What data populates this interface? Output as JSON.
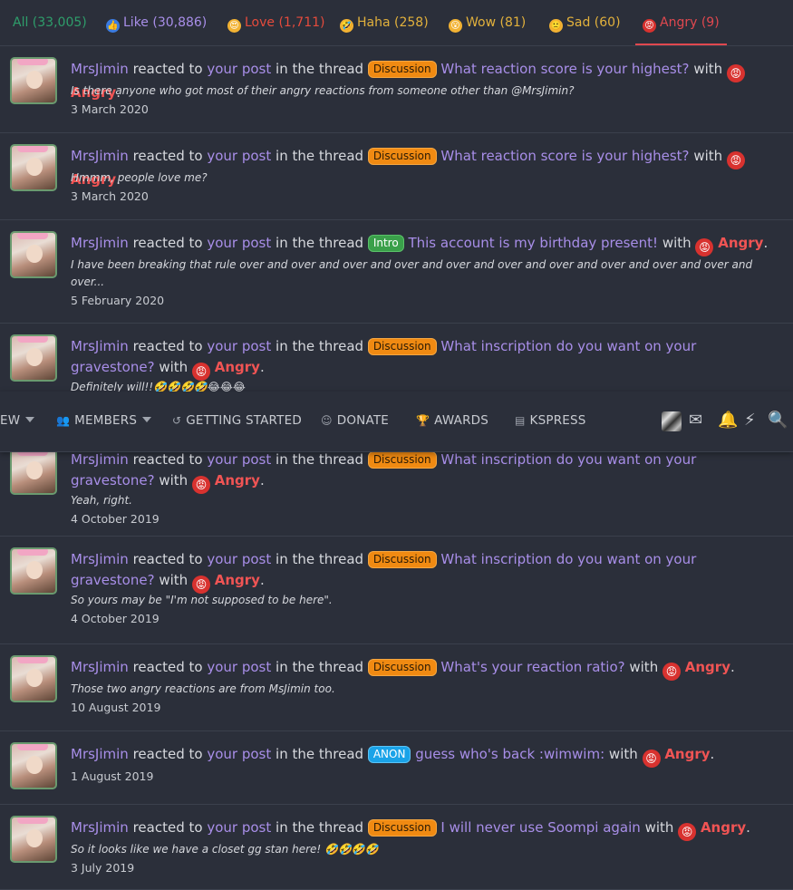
{
  "tabs": [
    {
      "label": "All (33,005)",
      "color": "#2e9e6b",
      "icon": ""
    },
    {
      "label": "Like (30,886)",
      "color": "#a88ee8",
      "icon": "like-icon"
    },
    {
      "label": "Love (1,711)",
      "color": "#e54b3c",
      "icon": "love-icon"
    },
    {
      "label": "Haha (258)",
      "color": "#e2b13c",
      "icon": "haha-icon"
    },
    {
      "label": "Wow (81)",
      "color": "#e2b13c",
      "icon": "wow-icon"
    },
    {
      "label": "Sad (60)",
      "color": "#e2b13c",
      "icon": "sad-icon"
    },
    {
      "label": "Angry (9)",
      "color": "#e0484f",
      "icon": "angry-icon"
    }
  ],
  "active_tab": "Angry (9)",
  "strings": {
    "reacted_to": "reacted to",
    "your_post": "your post",
    "in_the_thread": "in the thread",
    "with": "with",
    "angry": "Angry",
    "period": "."
  },
  "notifications": [
    {
      "user": "MrsJimin",
      "prefix": "Discussion",
      "title": "What reaction score is your highest?",
      "snippet": "Is there anyone who got most of their angry reactions from someone other than @MrsJimin?",
      "date": "3 March 2020"
    },
    {
      "user": "MrsJimin",
      "prefix": "Discussion",
      "title": "What reaction score is your highest?",
      "snippet": "Hmmm, people love me?",
      "date": "3 March 2020"
    },
    {
      "user": "MrsJimin",
      "prefix": "Intro",
      "title": "This account is my birthday present!",
      "snippet": "I have been breaking that rule over and over and over and over and over and over and over and over and over and over and over...",
      "date": "5 February 2020"
    },
    {
      "user": "MrsJimin",
      "prefix": "Discussion",
      "title": "What inscription do you want on your gravestone?",
      "snippet": "Definitely will!!🤣🤣🤣🤣😂😂😂",
      "date": ""
    },
    {
      "user": "MrsJimin",
      "prefix": "Discussion",
      "title": "What inscription do you want on your gravestone?",
      "snippet": "Yeah, right.",
      "date": "4 October 2019"
    },
    {
      "user": "MrsJimin",
      "prefix": "Discussion",
      "title": "What inscription do you want on your gravestone?",
      "snippet": "So yours may be \"I'm not supposed to be here\".",
      "date": "4 October 2019"
    },
    {
      "user": "MrsJimin",
      "prefix": "Discussion",
      "title": "What's your reaction ratio?",
      "snippet": "Those two angry reactions are from MsJimin too.",
      "date": "10 August 2019"
    },
    {
      "user": "MrsJimin",
      "prefix": "ANON",
      "title": "guess who's back :wimwim:",
      "snippet": "",
      "date": "1 August 2019"
    },
    {
      "user": "MrsJimin",
      "prefix": "Discussion",
      "title": "I will never use Soompi again",
      "snippet": "So it looks like we have a closet gg stan here! 🤣🤣🤣🤣",
      "date": "3 July 2019"
    }
  ],
  "prefix_colors": {
    "Discussion": {
      "bg": "#f08a12",
      "border": "#f5a742",
      "text": "#2a1a05"
    },
    "Intro": {
      "bg": "#3aa04a",
      "border": "#5bc26a",
      "text": "#ffffff"
    },
    "ANON": {
      "bg": "#1aa3e8",
      "border": "#5cc3f5",
      "text": "#ffffff"
    }
  },
  "nav": {
    "items": [
      {
        "label": "EW",
        "icon": "",
        "chevron": true
      },
      {
        "label": "MEMBERS",
        "icon": "members-icon",
        "chevron": true
      },
      {
        "label": "GETTING STARTED",
        "icon": "getting-started-icon",
        "chevron": false
      },
      {
        "label": "DONATE",
        "icon": "donate-icon",
        "chevron": false
      },
      {
        "label": "AWARDS",
        "icon": "trophy-icon",
        "chevron": false
      },
      {
        "label": "KSPRESS",
        "icon": "kspress-icon",
        "chevron": false
      }
    ],
    "right_icons": [
      "user-avatar",
      "inbox-icon",
      "alerts-bell-icon",
      "whats-new-icon",
      "search-icon"
    ]
  }
}
